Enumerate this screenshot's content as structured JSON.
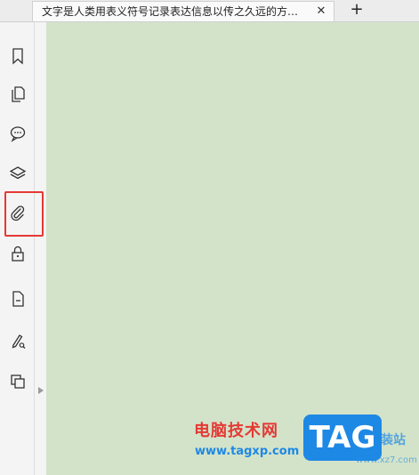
{
  "tabs": {
    "active_title": "文字是人类用表义符号记录表达信息以传之久远的方…",
    "close_icon": "close-icon",
    "new_tab_icon": "plus-icon"
  },
  "sidebar": {
    "items": [
      {
        "icon": "bookmark-icon"
      },
      {
        "icon": "pages-icon"
      },
      {
        "icon": "comment-icon"
      },
      {
        "icon": "layers-icon"
      },
      {
        "icon": "attachment-icon",
        "highlighted": true
      },
      {
        "icon": "lock-icon"
      },
      {
        "icon": "document-icon"
      },
      {
        "icon": "sign-icon"
      },
      {
        "icon": "compare-icon"
      }
    ],
    "highlight_color": "#e53935"
  },
  "document": {
    "background": "#d3e3c9"
  },
  "watermark": {
    "site_name": "电脑技术网",
    "url": "www.tagxp.com",
    "badge": "TAG",
    "side_text": "装站",
    "side_url": "www.xz7.com"
  }
}
